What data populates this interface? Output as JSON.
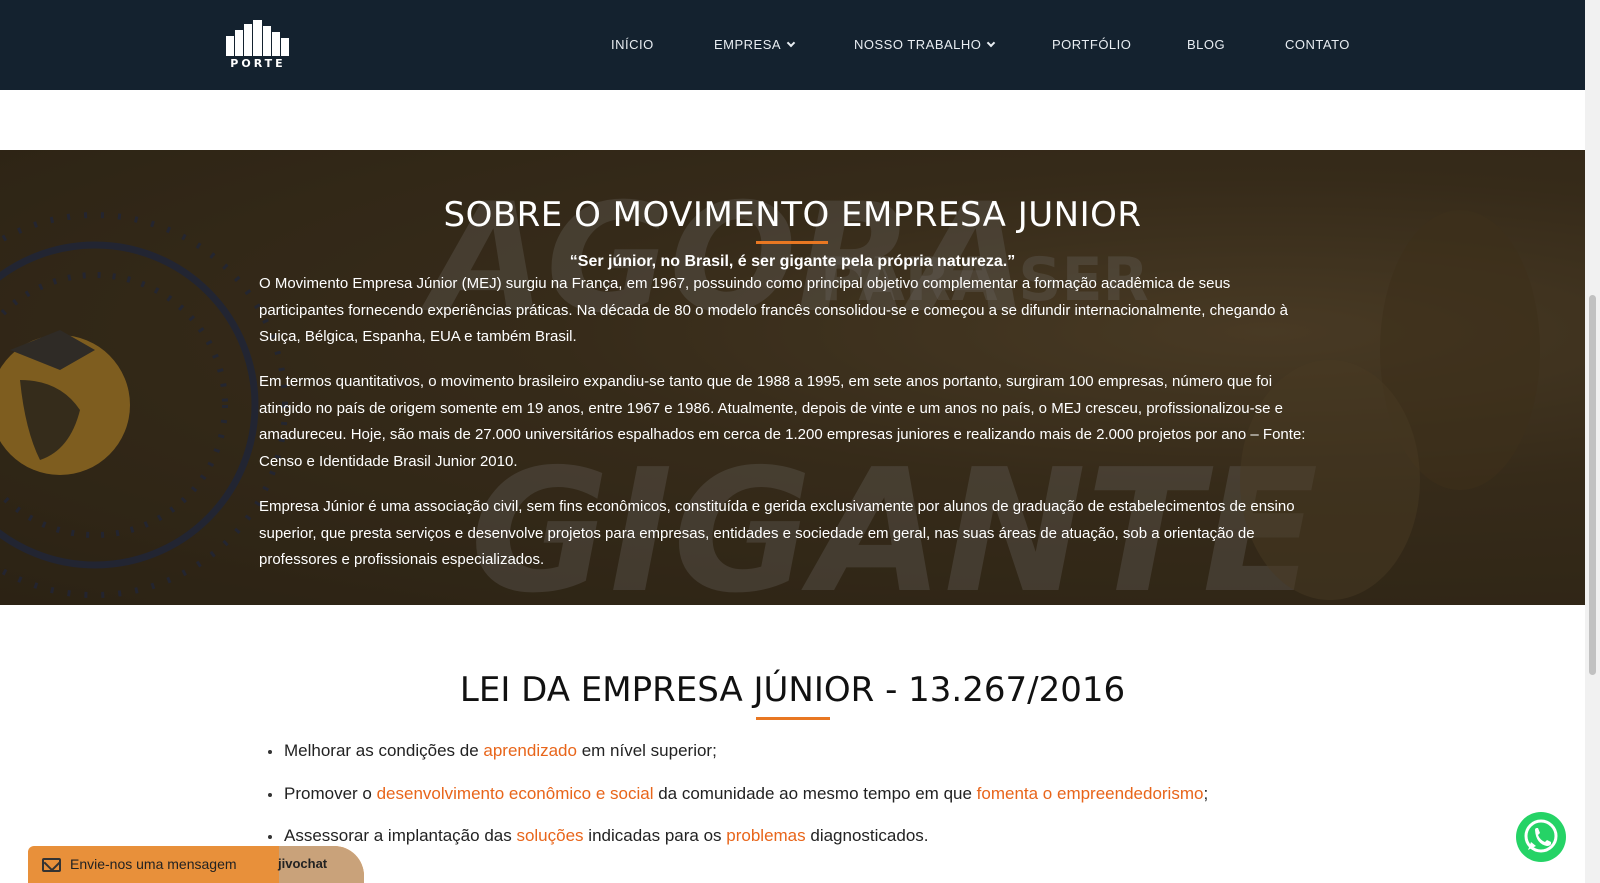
{
  "header": {
    "logo_text": "PORTE",
    "nav": [
      {
        "label": "INÍCIO"
      },
      {
        "label": "EMPRESA"
      },
      {
        "label": "NOSSO TRABALHO"
      },
      {
        "label": "PORTFÓLIO"
      },
      {
        "label": "BLOG"
      },
      {
        "label": "CONTATO"
      }
    ]
  },
  "hero": {
    "title": "SOBRE O MOVIMENTO EMPRESA JUNIOR",
    "quote": "“Ser júnior, no Brasil, é ser gigante pela própria natureza.”",
    "paragraphs": [
      "O Movimento Empresa Júnior (MEJ) surgiu na França, em 1967, possuindo como principal objetivo complementar a formação acadêmica de seus participantes fornecendo experiências práticas. Na década de 80 o modelo francês consolidou-se e começou a se difundir internacionalmente, chegando à Suiça, Bélgica, Espanha, EUA e também Brasil.",
      "Em termos quantitativos, o movimento brasileiro expandiu-se tanto que de 1988 a 1995, em sete anos portanto, surgiram 100 empresas, número que foi atingido no país de origem somente em 19 anos, entre 1967 e 1986. Atualmente, depois de vinte e um anos no país, o MEJ cresceu, profissionalizou-se e amadureceu. Hoje, são mais de 27.000 universitários espalhados em cerca de 1.200 empresas juniores e realizando mais de 2.000 projetos por ano – Fonte: Censo e Identidade Brasil Junior 2010.",
      "Empresa Júnior é uma associação civil, sem fins econômicos, constituída e gerida exclusivamente por alunos de graduação de estabelecimentos de ensino superior, que presta serviços e desenvolve projetos para empresas, entidades e sociedade em geral, nas suas áreas de atuação, sob a orientação de professores e profissionais especializados."
    ]
  },
  "law": {
    "title": "LEI DA EMPRESA JÚNIOR - 13.267/2016",
    "items": [
      {
        "a": "Melhorar as condições de ",
        "b": "aprendizado",
        "c": " em nível superior;",
        "d": "",
        "e": ""
      },
      {
        "a": "Promover o ",
        "b": "desenvolvimento econômico e social",
        "c": " da comunidade ao mesmo tempo em que ",
        "d": "fomenta o empreendedorismo",
        "e": ";"
      },
      {
        "a": "Assessorar a implantação das ",
        "b": "soluções",
        "c": " indicadas para os ",
        "d": "problemas",
        "e": " diagnosticados."
      }
    ]
  },
  "chat": {
    "label": "Envie-nos uma mensagem",
    "brand": "jivochat"
  },
  "colors": {
    "header_bg": "#14222f",
    "accent": "#e87722",
    "highlight": "#e8651a",
    "whatsapp": "#25d366"
  }
}
